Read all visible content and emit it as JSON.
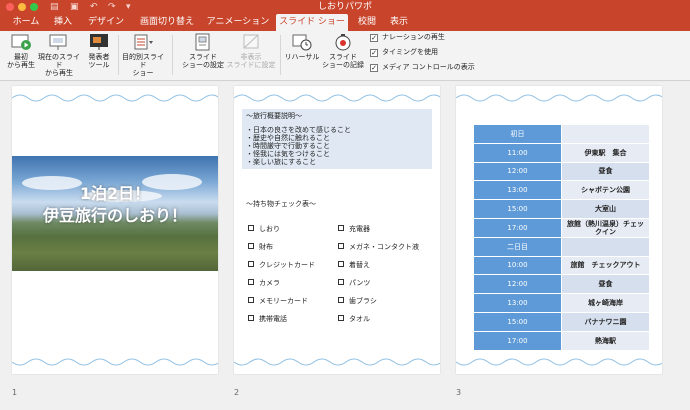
{
  "window": {
    "title": "しおりパワポ",
    "traffic_lights": [
      "#fc605c",
      "#fdbc40",
      "#34c84a"
    ]
  },
  "quick_access": [
    "save-icon",
    "undo-icon",
    "redo-icon",
    "dropdown-icon"
  ],
  "tabs": [
    "ホーム",
    "挿入",
    "デザイン",
    "画面切り替え",
    "アニメーション",
    "スライド ショー",
    "校閲",
    "表示"
  ],
  "active_tab": "スライド ショー",
  "ribbon": {
    "from_beginning": [
      "最初",
      "から再生"
    ],
    "from_current": [
      "現在のスライド",
      "から再生"
    ],
    "presenter": [
      "発表者",
      "ツール"
    ],
    "custom": [
      "目的別スライド",
      "ショー"
    ],
    "setup": [
      "スライド",
      "ショーの設定"
    ],
    "hide": [
      "非表示",
      "スライドに設定"
    ],
    "rehearse": "リハーサル",
    "record": [
      "スライド",
      "ショーの記録"
    ],
    "options": [
      "ナレーションの再生",
      "タイミングを使用",
      "メディア コントロールの表示"
    ]
  },
  "slides": {
    "numbers": [
      "1",
      "2",
      "3"
    ],
    "s1": {
      "line1": "1泊2日！",
      "line2": "伊豆旅行のしおり！"
    },
    "s2": {
      "overview_title": "～旅行概要説明～",
      "bullets": [
        "・日本の良さを改めて感じること",
        "・歴史や自然に触れること",
        "・時間厳守で行動すること",
        "・怪我には気をつけること",
        "・楽しい旅にすること"
      ],
      "checklist_title": "～持ち物チェック表～",
      "items_left": [
        "しおり",
        "財布",
        "クレジットカード",
        "カメラ",
        "メモリーカード",
        "携帯電話"
      ],
      "items_right": [
        "充電器",
        "メガネ・コンタクト液",
        "着替え",
        "パンツ",
        "歯ブラシ",
        "タオル"
      ]
    },
    "s3": {
      "day1": "初日",
      "day2": "二日目",
      "day1_rows": [
        {
          "time": "11:00",
          "activity": "伊東駅　集合"
        },
        {
          "time": "12:00",
          "activity": "昼食"
        },
        {
          "time": "13:00",
          "activity": "シャボテン公園"
        },
        {
          "time": "15:00",
          "activity": "大室山"
        },
        {
          "time": "17:00",
          "activity": "旅館（熱川温泉）チェックイン"
        }
      ],
      "day2_rows": [
        {
          "time": "10:00",
          "activity": "旅館　チェックアウト"
        },
        {
          "time": "12:00",
          "activity": "昼食"
        },
        {
          "time": "13:00",
          "activity": "城ヶ崎海岸"
        },
        {
          "time": "15:00",
          "activity": "バナナワニ園"
        },
        {
          "time": "17:00",
          "activity": "熱海駅"
        }
      ]
    }
  }
}
